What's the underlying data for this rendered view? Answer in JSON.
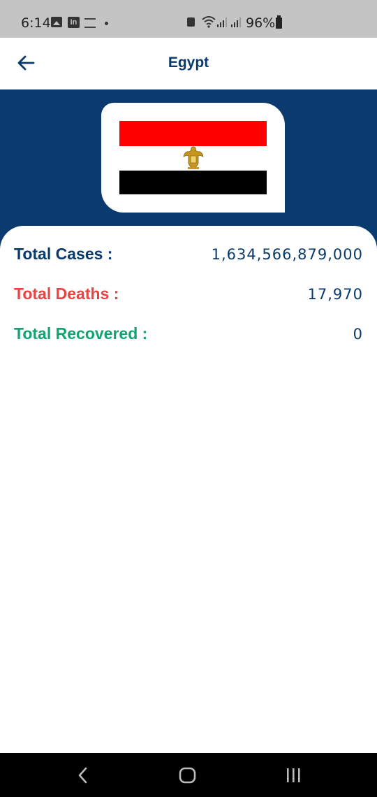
{
  "status_bar": {
    "time": "6:14",
    "battery_percent": "96%",
    "icons": [
      "gallery-icon",
      "linkedin-icon",
      "app-notification-icon",
      "dot-icon",
      "lock-icon",
      "wifi-icon",
      "signal-icon",
      "signal-icon",
      "battery-icon"
    ]
  },
  "app_bar": {
    "title": "Egypt",
    "back_icon": "arrow-left-icon"
  },
  "flag": {
    "country": "Egypt",
    "colors": [
      "#FE0000",
      "#FFFFFF",
      "#000000"
    ]
  },
  "stats": [
    {
      "label": "Total Cases :",
      "value": "1,634,566,879,000",
      "color": "#0A3A6B"
    },
    {
      "label": "Total Deaths :",
      "value": "17,970",
      "color": "#E84444"
    },
    {
      "label": "Total Recovered :",
      "value": "0",
      "color": "#13A36E"
    }
  ],
  "nav_bar": {
    "icons": [
      "back-icon",
      "home-icon",
      "recents-icon"
    ]
  },
  "colors": {
    "header_background": "#0B3A6E",
    "status_bar_background": "#C4C4C4",
    "navigation_bar_background": "#000000"
  }
}
